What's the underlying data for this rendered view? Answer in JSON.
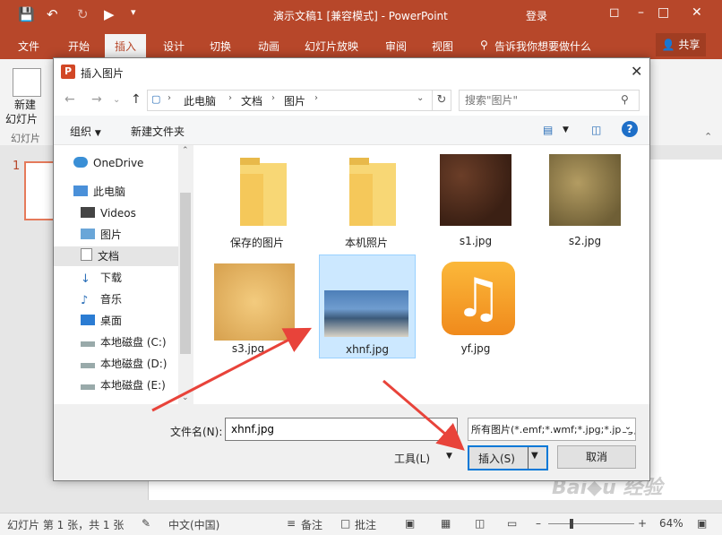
{
  "app": {
    "title": "演示文稿1 [兼容模式] - PowerPoint",
    "login": "登录",
    "share": "共享",
    "tabs": [
      "文件",
      "开始",
      "插入",
      "设计",
      "切换",
      "动画",
      "幻灯片放映",
      "审阅",
      "视图"
    ],
    "tell_me": "告诉我你想要做什么",
    "ribbon": {
      "new_slide_1": "新建",
      "new_slide_2": "幻灯片",
      "group": "幻灯片"
    },
    "slide_num": "1"
  },
  "dialog": {
    "title": "插入图片",
    "breadcrumb": [
      "此电脑",
      "文档",
      "图片"
    ],
    "search_placeholder": "搜索\"图片\"",
    "organize": "组织",
    "new_folder": "新建文件夹",
    "tree": [
      {
        "label": "OneDrive",
        "icon": "cloud-icon"
      },
      {
        "label": "此电脑",
        "icon": "computer-icon"
      },
      {
        "label": "Videos",
        "icon": "video-icon"
      },
      {
        "label": "图片",
        "icon": "picture-icon"
      },
      {
        "label": "文档",
        "icon": "document-icon",
        "selected": true
      },
      {
        "label": "下载",
        "icon": "download-icon"
      },
      {
        "label": "音乐",
        "icon": "music-icon"
      },
      {
        "label": "桌面",
        "icon": "desktop-icon"
      },
      {
        "label": "本地磁盘 (C:)",
        "icon": "drive-icon"
      },
      {
        "label": "本地磁盘 (D:)",
        "icon": "drive-icon"
      },
      {
        "label": "本地磁盘 (E:)",
        "icon": "drive-icon"
      }
    ],
    "files": [
      {
        "label": "保存的图片",
        "kind": "folder"
      },
      {
        "label": "本机照片",
        "kind": "folder"
      },
      {
        "label": "s1.jpg",
        "kind": "image",
        "color": "#4a2b1c"
      },
      {
        "label": "s2.jpg",
        "kind": "image",
        "color": "#8c7a4e"
      },
      {
        "label": "s3.jpg",
        "kind": "image",
        "color": "#e7bd6e"
      },
      {
        "label": "xhnf.jpg",
        "kind": "photo",
        "selected": true
      },
      {
        "label": "yf.jpg",
        "kind": "music-app"
      }
    ],
    "filename_label": "文件名(N):",
    "filename_value": "xhnf.jpg",
    "filter": "所有图片(*.emf;*.wmf;*.jpg;*.jpeg)",
    "tools": "工具(L)",
    "insert": "插入(S)",
    "cancel": "取消"
  },
  "status": {
    "slide_info": "幻灯片 第 1 张，共 1 张",
    "language": "中文(中国)",
    "notes": "备注",
    "comments": "批注",
    "zoom": "64%"
  },
  "colors": {
    "accent": "#b7472a",
    "selection": "#cce8ff",
    "arrow": "#e8433a"
  }
}
